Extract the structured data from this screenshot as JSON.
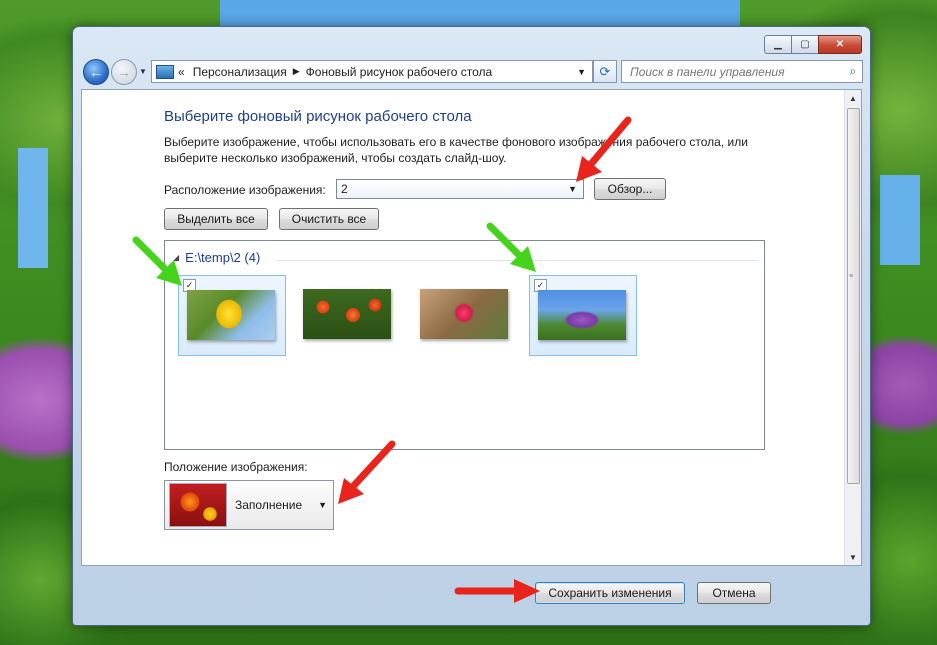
{
  "window": {
    "breadcrumb": [
      "Персонализация",
      "Фоновый рисунок рабочего стола"
    ],
    "search_placeholder": "Поиск в панели управления"
  },
  "main": {
    "title": "Выберите фоновый рисунок рабочего стола",
    "description": "Выберите изображение, чтобы использовать его в качестве фонового изображения рабочего стола, или выберите несколько изображений, чтобы создать слайд-шоу.",
    "location_label": "Расположение изображения:",
    "location_value": "2",
    "browse_label": "Обзор...",
    "select_all_label": "Выделить все",
    "clear_all_label": "Очистить все",
    "group_title": "E:\\temp\\2 (4)",
    "images": [
      {
        "checked": true
      },
      {
        "checked": false
      },
      {
        "checked": false
      },
      {
        "checked": true
      }
    ],
    "position_label": "Положение изображения:",
    "position_value": "Заполнение"
  },
  "footer": {
    "save_label": "Сохранить изменения",
    "cancel_label": "Отмена"
  },
  "colors": {
    "annotation_red": "#e8241c",
    "annotation_green": "#46d31c",
    "title_blue": "#1e3f8a"
  }
}
